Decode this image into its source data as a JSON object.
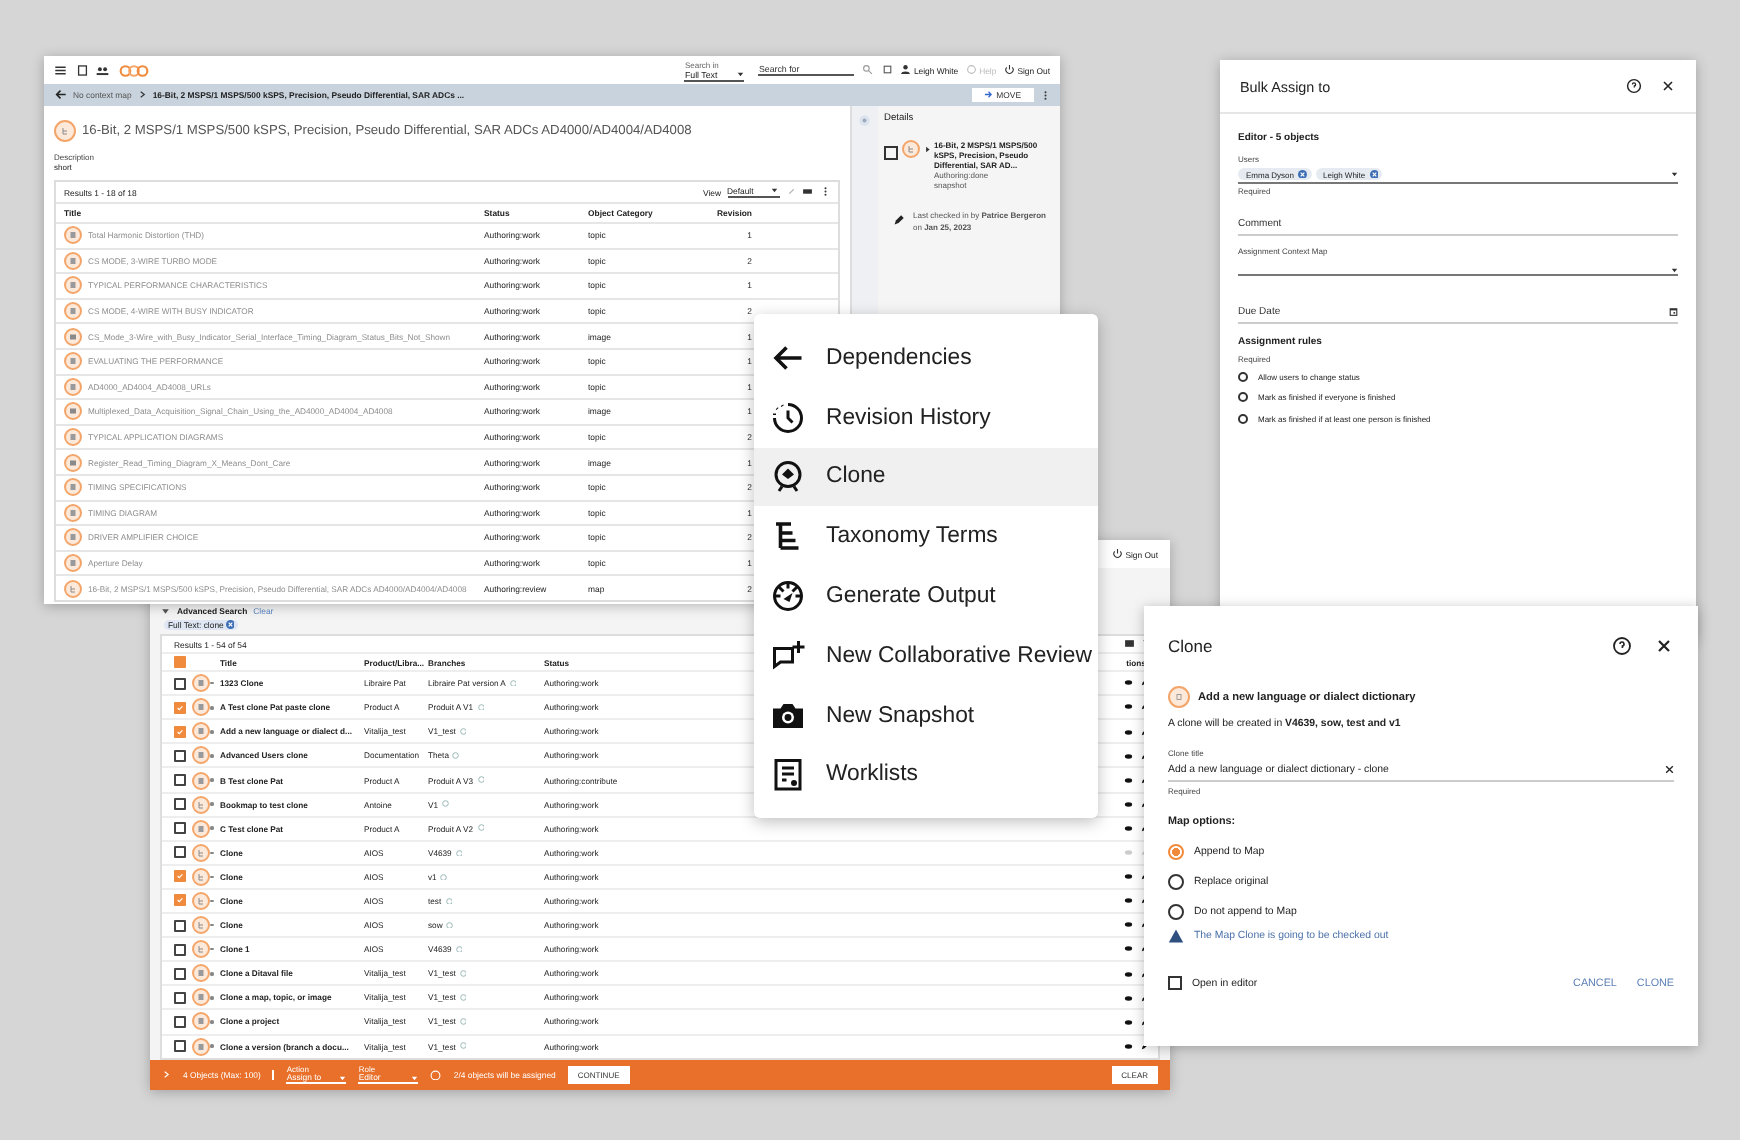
{
  "main_window": {
    "top_bar": {
      "search_in_label": "Search in",
      "search_in_value": "Full Text",
      "search_placeholder": "Search for",
      "user": "Leigh White",
      "help": {
        "label": "Help",
        "disabled": true
      },
      "sign_out": "Sign Out"
    },
    "breadcrumb": {
      "context": "No context map",
      "path": "16-Bit, 2 MSPS/1 MSPS/500 kSPS, Precision, Pseudo Differential, SAR ADCs ...",
      "move_button": "MOVE"
    },
    "title": "16-Bit, 2 MSPS/1 MSPS/500 kSPS, Precision, Pseudo Differential, SAR ADCs AD4000/AD4004/AD4008",
    "description_label": "Description",
    "description": "short",
    "results": "Results 1 - 18 of 18",
    "view_label": "View",
    "view_value": "Default",
    "columns": [
      "Title",
      "Status",
      "Object Category",
      "Revision"
    ],
    "rows": [
      {
        "kind": "topic",
        "title": "Total Harmonic Distortion (THD)",
        "status": "Authoring:work",
        "category": "topic",
        "revision": "1"
      },
      {
        "kind": "topic",
        "title": "CS MODE, 3-WIRE TURBO MODE",
        "status": "Authoring:work",
        "category": "topic",
        "revision": "2"
      },
      {
        "kind": "topic",
        "title": "TYPICAL PERFORMANCE CHARACTERISTICS",
        "status": "Authoring:work",
        "category": "topic",
        "revision": "1"
      },
      {
        "kind": "topic",
        "title": "CS MODE, 4-WIRE WITH BUSY INDICATOR",
        "status": "Authoring:work",
        "category": "topic",
        "revision": "2"
      },
      {
        "kind": "image",
        "title": "CS_Mode_3-Wire_with_Busy_Indicator_Serial_Interface_Timing_Diagram_Status_Bits_Not_Shown",
        "status": "Authoring:work",
        "category": "image",
        "revision": "1"
      },
      {
        "kind": "topic",
        "title": "EVALUATING THE PERFORMANCE",
        "status": "Authoring:work",
        "category": "topic",
        "revision": "1"
      },
      {
        "kind": "topic",
        "title": "AD4000_AD4004_AD4008_URLs",
        "status": "Authoring:work",
        "category": "topic",
        "revision": "1"
      },
      {
        "kind": "image",
        "title": "Multiplexed_Data_Acquisition_Signal_Chain_Using_the_AD4000_AD4004_AD4008",
        "status": "Authoring:work",
        "category": "image",
        "revision": "1"
      },
      {
        "kind": "topic",
        "title": "TYPICAL APPLICATION DIAGRAMS",
        "status": "Authoring:work",
        "category": "topic",
        "revision": "2"
      },
      {
        "kind": "image",
        "title": "Register_Read_Timing_Diagram_X_Means_Dont_Care",
        "status": "Authoring:work",
        "category": "image",
        "revision": "1"
      },
      {
        "kind": "topic",
        "title": "TIMING SPECIFICATIONS",
        "status": "Authoring:work",
        "category": "topic",
        "revision": "2"
      },
      {
        "kind": "topic",
        "title": "TIMING DIAGRAM",
        "status": "Authoring:work",
        "category": "topic",
        "revision": "1"
      },
      {
        "kind": "topic",
        "title": "DRIVER AMPLIFIER CHOICE",
        "status": "Authoring:work",
        "category": "topic",
        "revision": "2"
      },
      {
        "kind": "topic",
        "title": "Aperture Delay",
        "status": "Authoring:work",
        "category": "topic",
        "revision": "1"
      },
      {
        "kind": "map",
        "title": "16-Bit, 2 MSPS/1 MSPS/500 kSPS, Precision, Pseudo Differential, SAR ADCs AD4000/AD4004/AD4008",
        "status": "Authoring:review",
        "category": "map",
        "revision": "2"
      }
    ],
    "details": {
      "heading": "Details",
      "item_checked": false,
      "item_title": "16-Bit, 2 MSPS/1 MSPS/500 kSPS, Precision, Pseudo Differential, SAR AD...",
      "item_status": "Authoring:done",
      "item_type": "snapshot",
      "checked_in": "Last checked in by **Patrice Bergeron** on **Jan 25, 2023**"
    }
  },
  "search_window": {
    "sign_out": "Sign Out",
    "advanced_search": "Advanced Search",
    "clear_link": "Clear",
    "filter_chip": "Full Text: clone",
    "results": "Results 1 - 54 of 54",
    "select_all_partial": true,
    "columns": [
      "Title",
      "Product/Libra...",
      "Branches",
      "Status",
      "tions"
    ],
    "rows": [
      {
        "kind": "topic",
        "checked": false,
        "disabled": false,
        "title": "1323 Clone",
        "product": "Libraire Pat",
        "branch": "Libraire Pat version A",
        "status": "Authoring:work"
      },
      {
        "kind": "topic",
        "checked": true,
        "disabled": false,
        "title": "A Test clone Pat paste clone",
        "product": "Product A",
        "branch": "Produit A V1",
        "status": "Authoring:work"
      },
      {
        "kind": "topic",
        "checked": true,
        "disabled": false,
        "title": "Add a new language or dialect d...",
        "product": "Vitalija_test",
        "branch": "V1_test",
        "status": "Authoring:work"
      },
      {
        "kind": "topic",
        "checked": false,
        "disabled": false,
        "title": "Advanced Users clone",
        "product": "Documentation",
        "branch": "Theta",
        "status": "Authoring:work"
      },
      {
        "kind": "topic",
        "checked": false,
        "disabled": false,
        "title": "B Test clone Pat",
        "product": "Product A",
        "branch": "Produit A V3",
        "status": "Authoring:contribute"
      },
      {
        "kind": "map",
        "checked": false,
        "disabled": false,
        "title": "Bookmap to test clone",
        "product": "Antoine",
        "branch": "V1",
        "status": "Authoring:work"
      },
      {
        "kind": "topic",
        "checked": false,
        "disabled": false,
        "title": "C Test clone Pat",
        "product": "Product A",
        "branch": "Produit A V2",
        "status": "Authoring:work"
      },
      {
        "kind": "map",
        "checked": false,
        "disabled": true,
        "title": "Clone",
        "product": "AIOS",
        "branch": "V4639",
        "status": "Authoring:work"
      },
      {
        "kind": "map",
        "checked": true,
        "disabled": false,
        "title": "Clone",
        "product": "AIOS",
        "branch": "v1",
        "status": "Authoring:work"
      },
      {
        "kind": "map",
        "checked": true,
        "disabled": false,
        "title": "Clone",
        "product": "AIOS",
        "branch": "test",
        "status": "Authoring:work"
      },
      {
        "kind": "map",
        "checked": false,
        "disabled": false,
        "title": "Clone",
        "product": "AIOS",
        "branch": "sow",
        "status": "Authoring:work"
      },
      {
        "kind": "map",
        "checked": false,
        "disabled": false,
        "title": "Clone 1",
        "product": "AIOS",
        "branch": "V4639",
        "status": "Authoring:work"
      },
      {
        "kind": "topic",
        "checked": false,
        "disabled": false,
        "title": "Clone a Ditaval file",
        "product": "Vitalija_test",
        "branch": "V1_test",
        "status": "Authoring:work"
      },
      {
        "kind": "topic",
        "checked": false,
        "disabled": false,
        "title": "Clone a map, topic, or image",
        "product": "Vitalija_test",
        "branch": "V1_test",
        "status": "Authoring:work"
      },
      {
        "kind": "topic",
        "checked": false,
        "disabled": false,
        "title": "Clone a project",
        "product": "Vitalija_test",
        "branch": "V1_test",
        "status": "Authoring:work"
      },
      {
        "kind": "topic",
        "checked": false,
        "disabled": false,
        "title": "Clone a version (branch a docu...",
        "product": "Vitalija_test",
        "branch": "V1_test",
        "status": "Authoring:work"
      }
    ],
    "bulk_bar": {
      "count": "4 Objects (Max: 100)",
      "action_label": "Action",
      "action_value": "Assign to",
      "role_label": "Role",
      "role_value": "Editor",
      "info": "2/4 objects will be assigned",
      "continue": "CONTINUE",
      "clear": "CLEAR"
    }
  },
  "context_menu": {
    "items": [
      {
        "kind": "arrow",
        "label": "Dependencies",
        "selected": false
      },
      {
        "kind": "history",
        "label": "Revision History",
        "selected": false
      },
      {
        "kind": "clone",
        "label": "Clone",
        "selected": true
      },
      {
        "kind": "taxonomy",
        "label": "Taxonomy Terms",
        "selected": false
      },
      {
        "kind": "output",
        "label": "Generate Output",
        "selected": false
      },
      {
        "kind": "review",
        "label": "New Collaborative Review",
        "selected": false
      },
      {
        "kind": "snapshot",
        "label": "New Snapshot",
        "selected": false
      },
      {
        "kind": "worklist",
        "label": "Worklists",
        "selected": false
      }
    ]
  },
  "bulk_assign": {
    "title": "Bulk Assign to",
    "section": "Editor - 5 objects",
    "users_label": "Users",
    "users": [
      "Emma Dyson",
      "Leigh White"
    ],
    "users_hint": "Required",
    "comment_placeholder": "Comment",
    "context_map_label": "Assignment Context Map",
    "due_date_placeholder": "Due Date",
    "rules_heading": "Assignment rules",
    "rules_hint": "Required",
    "rules": [
      {
        "label": "Allow users to change status",
        "selected": false
      },
      {
        "label": "Mark as finished if everyone is finished",
        "selected": false
      },
      {
        "label": "Mark as finished if at least one person is finished",
        "selected": false
      }
    ]
  },
  "clone_dialog": {
    "title": "Clone",
    "object_title": "Add a new language or dialect dictionary",
    "info": "A clone will be created in **V4639, sow, test and v1**",
    "field_label": "Clone title",
    "field_value": "Add a new language or dialect dictionary - clone",
    "field_hint": "Required",
    "options_heading": "Map options:",
    "options": [
      {
        "label": "Append to Map",
        "selected": true
      },
      {
        "label": "Replace original",
        "selected": false
      },
      {
        "label": "Do not append to Map",
        "selected": false
      }
    ],
    "warning": "The Map Clone is going to be checked out",
    "open_in_editor": {
      "label": "Open in editor",
      "checked": false
    },
    "cancel": "CANCEL",
    "clone": "CLONE"
  }
}
